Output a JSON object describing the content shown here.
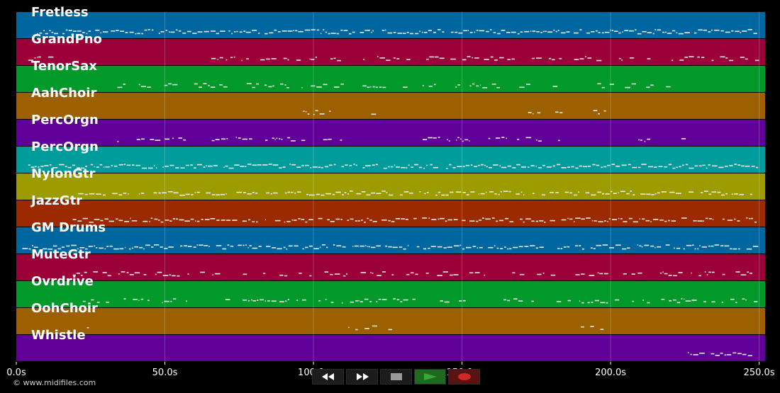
{
  "app": {
    "copyright": "© www.midifiles.com"
  },
  "tracks": [
    {
      "name": "Fretless",
      "color": "#00669f",
      "density": 0.95,
      "start": 7,
      "end": 249,
      "gaps": []
    },
    {
      "name": "GrandPno",
      "color": "#9c0039",
      "density": 0.55,
      "start": 4,
      "end": 249,
      "gaps": [
        [
          11,
          65
        ],
        [
          221,
          223
        ]
      ]
    },
    {
      "name": "TenorSax",
      "color": "#00992a",
      "density": 0.6,
      "start": 34,
      "end": 219,
      "gaps": [
        [
          110,
          116
        ],
        [
          124,
          130
        ],
        [
          182,
          194
        ]
      ]
    },
    {
      "name": "AahChoir",
      "color": "#9c6000",
      "density": 0.6,
      "start": 95,
      "end": 198,
      "gaps": [
        [
          110,
          118
        ],
        [
          121,
          171
        ],
        [
          183,
          193
        ]
      ]
    },
    {
      "name": "PercOrgn",
      "color": "#610099",
      "density": 0.6,
      "start": 34,
      "end": 228,
      "gaps": [
        [
          110,
          133
        ],
        [
          185,
          209
        ],
        [
          213,
          223
        ]
      ]
    },
    {
      "name": "PercOrgn",
      "color": "#009c9c",
      "density": 0.95,
      "start": 4,
      "end": 249,
      "gaps": []
    },
    {
      "name": "NylonGtr",
      "color": "#9c9c00",
      "density": 0.85,
      "start": 19,
      "end": 249,
      "gaps": []
    },
    {
      "name": "JazzGtr",
      "color": "#9c2a00",
      "density": 0.85,
      "start": 19,
      "end": 249,
      "gaps": []
    },
    {
      "name": "GM Drums",
      "color": "#00669f",
      "density": 0.9,
      "start": 2,
      "end": 249,
      "gaps": []
    },
    {
      "name": "MuteGtr",
      "color": "#9c0039",
      "density": 0.45,
      "start": 19,
      "end": 249,
      "gaps": []
    },
    {
      "name": "Ovrdrive",
      "color": "#00992a",
      "density": 0.45,
      "start": 19,
      "end": 249,
      "gaps": []
    },
    {
      "name": "OohChoir",
      "color": "#9c6000",
      "density": 0.5,
      "start": 22,
      "end": 200,
      "gaps": [
        [
          32,
          111
        ],
        [
          126,
          187
        ]
      ]
    },
    {
      "name": "Whistle",
      "color": "#610099",
      "density": 0.8,
      "start": 226,
      "end": 248,
      "gaps": []
    }
  ],
  "timeline": {
    "min_seconds": 0,
    "max_seconds": 252,
    "ticks": [
      {
        "value": 0,
        "label": "0.0s"
      },
      {
        "value": 50,
        "label": "50.0s"
      },
      {
        "value": 100,
        "label": "100.0s"
      },
      {
        "value": 150,
        "label": "150.0s"
      },
      {
        "value": 200,
        "label": "200.0s"
      },
      {
        "value": 250,
        "label": "250.0s"
      }
    ]
  },
  "transport": {
    "rewind": "rewind-icon",
    "fast_forward": "fast-forward-icon",
    "stop": "stop-icon",
    "play": "play-icon",
    "record": "record-icon",
    "play_color": "#3aa63a",
    "record_color": "#d02828"
  }
}
